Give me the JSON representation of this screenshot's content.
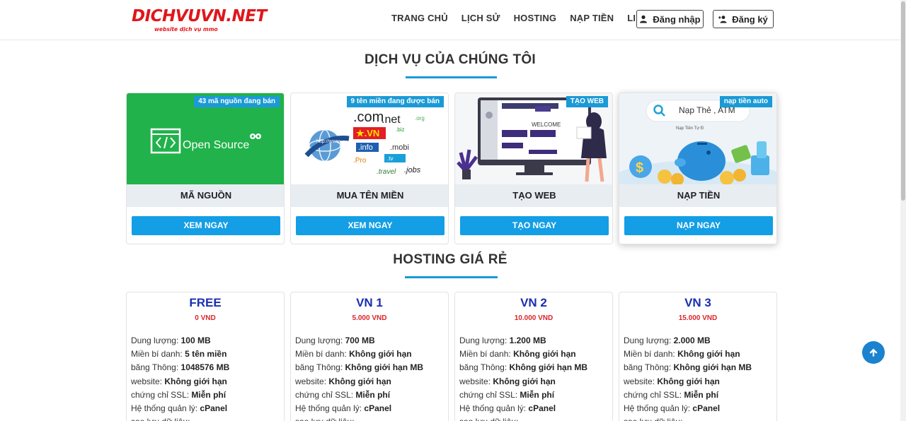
{
  "brand": {
    "title": "DICHVUVN.NET",
    "tagline": "website dịch vụ mmo"
  },
  "nav": {
    "items": [
      "TRANG CHỦ",
      "LỊCH SỬ",
      "HOSTING",
      "NẠP TIỀN",
      "LIÊN HỆ"
    ],
    "login": "Đăng nhập",
    "register": "Đăng ký"
  },
  "services": {
    "title": "DỊCH VỤ CỦA CHÚNG TÔI",
    "cards": [
      {
        "badge": "43 mã nguồn đang bán",
        "name": "MÃ NGUỒN",
        "button": "XEM NGAY",
        "image_text": "Open Source"
      },
      {
        "badge": "9 tên miền đang được bán",
        "name": "MUA TÊN MIỀN",
        "button": "XEM NGAY",
        "image_words": [
          ".com",
          ".net",
          "★.VN",
          ".info",
          ".mobi",
          ".Pro",
          ".travel",
          ".jobs",
          ".biz",
          ".org",
          ".tv",
          "http://www."
        ]
      },
      {
        "badge": "TẠO WEB",
        "name": "TẠO WEB",
        "button": "TẠO NGAY",
        "image_text": "WELCOME"
      },
      {
        "badge": "nạp tiền auto",
        "name": "NẠP TIỀN",
        "button": "NẠP NGAY",
        "image_text": "Nạp Thẻ , ATM",
        "image_subtext": "Nạp Tiền Tự Đ"
      }
    ]
  },
  "hosting": {
    "title": "HOSTING GIÁ RẺ",
    "plans": [
      {
        "name": "FREE",
        "price": "0 VND",
        "specs": [
          {
            "label": "Dung lượng: ",
            "value": "100 MB"
          },
          {
            "label": "Miền bí danh: ",
            "value": "5 tên miền"
          },
          {
            "label": "băng Thông: ",
            "value": "1048576 MB"
          },
          {
            "label": "website: ",
            "value": "Không giới hạn"
          },
          {
            "label": "chứng chỉ SSL: ",
            "value": "Miễn phí"
          },
          {
            "label": "Hệ thống quản lý: ",
            "value": "cPanel"
          },
          {
            "label": "sao lưu dữ liệu: ",
            "value": ""
          }
        ]
      },
      {
        "name": "VN 1",
        "price": "5.000 VND",
        "specs": [
          {
            "label": "Dung lượng: ",
            "value": "700 MB"
          },
          {
            "label": "Miền bí danh: ",
            "value": "Không giới hạn"
          },
          {
            "label": "băng Thông: ",
            "value": "Không giới hạn MB"
          },
          {
            "label": "website: ",
            "value": "Không giới hạn"
          },
          {
            "label": "chứng chỉ SSL: ",
            "value": "Miễn phí"
          },
          {
            "label": "Hệ thống quản lý: ",
            "value": "cPanel"
          },
          {
            "label": "sao lưu dữ liệu: ",
            "value": ""
          }
        ]
      },
      {
        "name": "VN 2",
        "price": "10.000 VND",
        "specs": [
          {
            "label": "Dung lượng: ",
            "value": "1.200 MB"
          },
          {
            "label": "Miền bí danh: ",
            "value": "Không giới hạn"
          },
          {
            "label": "băng Thông: ",
            "value": "Không giới hạn MB"
          },
          {
            "label": "website: ",
            "value": "Không giới hạn"
          },
          {
            "label": "chứng chỉ SSL: ",
            "value": "Miễn phí"
          },
          {
            "label": "Hệ thống quản lý: ",
            "value": "cPanel"
          },
          {
            "label": "sao lưu dữ liệu: ",
            "value": ""
          }
        ]
      },
      {
        "name": "VN 3",
        "price": "15.000 VND",
        "specs": [
          {
            "label": "Dung lượng: ",
            "value": "2.000 MB"
          },
          {
            "label": "Miền bí danh: ",
            "value": "Không giới hạn"
          },
          {
            "label": "băng Thông: ",
            "value": "Không giới hạn MB"
          },
          {
            "label": "website: ",
            "value": "Không giới hạn"
          },
          {
            "label": "chứng chỉ SSL: ",
            "value": "Miễn phí"
          },
          {
            "label": "Hệ thống quản lý: ",
            "value": "cPanel"
          },
          {
            "label": "sao lưu dữ liệu: ",
            "value": ""
          }
        ]
      }
    ]
  },
  "colors": {
    "brand_red": "#e0161b",
    "accent_blue": "#139ee6",
    "plan_name": "#1a2fb0",
    "price_red": "#d9262b"
  },
  "icons": {
    "login": "user-icon",
    "register": "user-plus-icon",
    "back_to_top": "arrow-up-icon"
  }
}
